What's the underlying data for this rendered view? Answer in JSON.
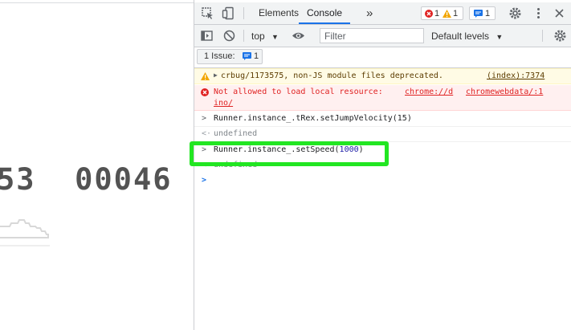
{
  "game": {
    "score_left": "53",
    "score_right": "00046"
  },
  "devtools": {
    "tabs": [
      {
        "label": "Elements"
      },
      {
        "label": "Console"
      }
    ],
    "more_tabs_glyph": "»",
    "error_count": "1",
    "warning_count": "1",
    "issue_count_badge": "1",
    "toolbar": {
      "context": "top",
      "filter_placeholder": "Filter",
      "levels": "Default levels"
    },
    "issues": {
      "label": "1 Issue:",
      "count": "1"
    },
    "console": {
      "warning": {
        "text": "crbug/1173575, non-JS module files deprecated.",
        "source": "(index):7374"
      },
      "error": {
        "text_prefix": "Not allowed to load local resource: ",
        "link_part1": "chrome://d",
        "link_part2": "chromewebdata/:1",
        "link_part3": "ino/"
      },
      "input1": "Runner.instance_.tRex.setJumpVelocity(15)",
      "output1": "undefined",
      "input2_prefix": "Runner.instance_.setSpeed(",
      "input2_number": "1000",
      "input2_suffix": ")",
      "output2": "undefined"
    },
    "colors": {
      "accent": "#1a73e8",
      "highlight": "#22e622",
      "error": "#e02323",
      "warning_bg": "#fffbe5"
    }
  }
}
